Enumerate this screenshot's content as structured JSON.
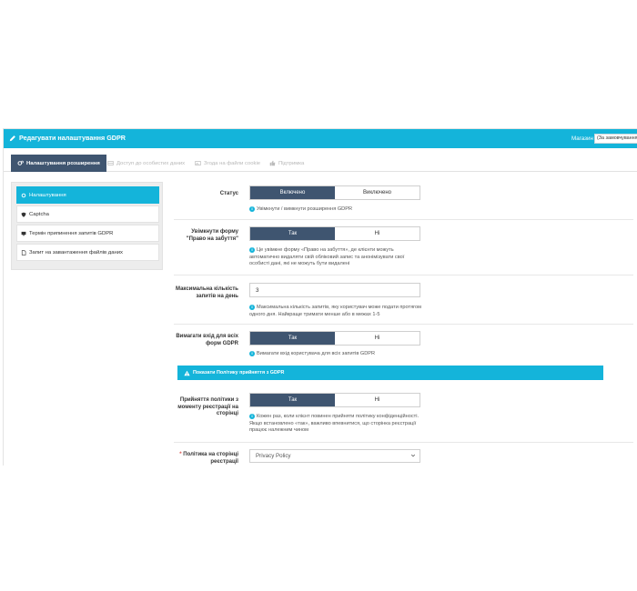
{
  "header": {
    "title": "Редагувати налаштування GDPR",
    "store_label": "Магазин",
    "store_value": "(За замовчуванням)"
  },
  "tabs": [
    {
      "label": "Налаштування розширення",
      "icon": "cogs-icon"
    },
    {
      "label": "Доступ до особистих даних",
      "icon": "table-icon"
    },
    {
      "label": "Згода на файли cookie",
      "icon": "image-icon"
    },
    {
      "label": "Підтримка",
      "icon": "thumbs-up-icon"
    }
  ],
  "sidebar": {
    "items": [
      {
        "label": "Налаштування",
        "icon": "cog-icon"
      },
      {
        "label": "Captcha",
        "icon": "shield-icon"
      },
      {
        "label": "Термін припинення запитів GDPR",
        "icon": "monitor-icon"
      },
      {
        "label": "Запит на завантаження файлів даних",
        "icon": "file-icon"
      }
    ]
  },
  "form": {
    "status": {
      "label": "Статус",
      "on": "Включено",
      "off": "Виключено",
      "help": "Увімкнути / вимкнути розширення GDPR"
    },
    "forget": {
      "label": "Увімкнути форму \"Право на забуття\"",
      "on": "Так",
      "off": "Ні",
      "help": "Це увімкне форму «Право на забуття», де клієнти можуть автоматично видаляти свій обліковий запис та анонімізувати свої особисті дані, які не можуть бути видалені"
    },
    "max_requests": {
      "label": "Максимальна кількість запитів на день",
      "value": "3",
      "help": "Максимальна кількість запитів, яку користувач може подати протягом одного дня. Найкраще тримати менше або в межах 1-5"
    },
    "login_required": {
      "label": "Вимагати вхід для всіх форм GDPR",
      "on": "Так",
      "off": "Ні",
      "help": "Вимагати вхід користувача для всіх запитів GDPR"
    },
    "alert": "Показати Політику прийняття з GDPR",
    "accept_policy": {
      "label": "Прийняття політики з моменту реєстрації на сторінці",
      "on": "Так",
      "off": "Ні",
      "help": "Кожен раз, коли клієнт повинен прийняти політику конфіденційності. Якщо встановлено «так», важливо впевнитися, що сторінка реєстрації працює належним чином"
    },
    "policy_page": {
      "required_mark": "*",
      "label": "Політика на сторінці реєстрації",
      "value": "Privacy Policy"
    }
  },
  "colors": {
    "accent": "#14b4da",
    "dark": "#3f5570"
  }
}
